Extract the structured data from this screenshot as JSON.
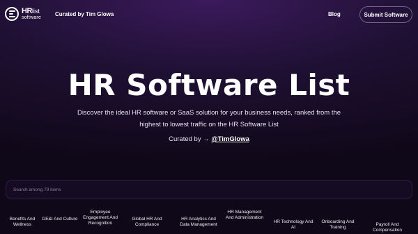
{
  "header": {
    "logo": {
      "hr": "HR",
      "list": "list",
      "software": "software"
    },
    "curated_by": "Curated by Tim Glowa",
    "blog_label": "Blog",
    "submit_label": "Submit Software"
  },
  "hero": {
    "title": "HR Software List",
    "subtitle": "Discover the ideal HR software or SaaS solution for your business needs, ranked from the highest to lowest traffic on the HR Software List",
    "curated_prefix": "Curated by →",
    "curated_handle": "@TimGlowa"
  },
  "search": {
    "placeholder": "Search among 79 items",
    "value": ""
  },
  "categories": [
    {
      "label": "Benefits And Wellness"
    },
    {
      "label": "DE&I And Culture"
    },
    {
      "label": "Employee Engagement And Recognition"
    },
    {
      "label": "Global HR And Compliance"
    },
    {
      "label": "HR Analytics And Data Management"
    },
    {
      "label": "HR Management And Administration"
    },
    {
      "label": "HR Technology And AI"
    },
    {
      "label": "Onboarding And Training"
    },
    {
      "label": "Payroll And Compensation"
    }
  ]
}
